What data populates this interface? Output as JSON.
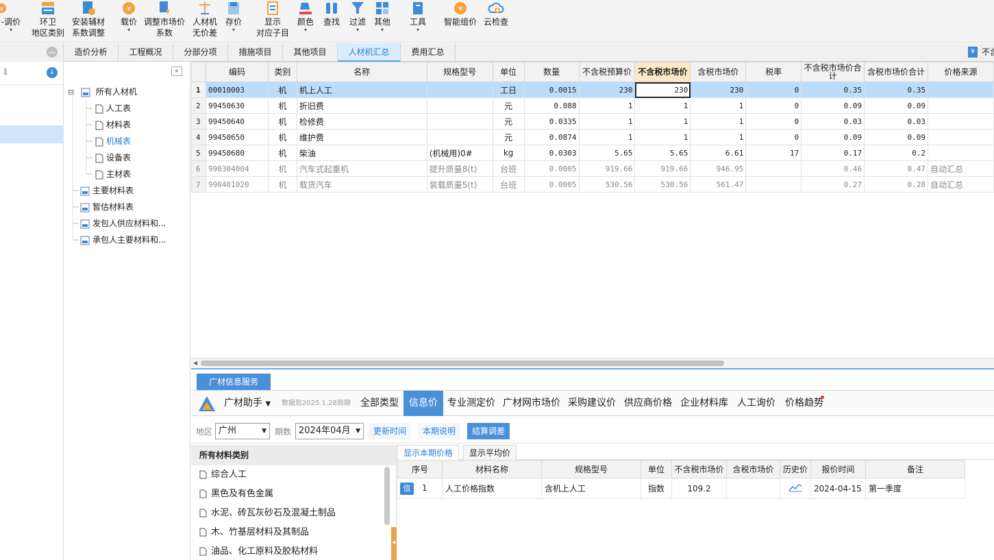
{
  "toolbar": {
    "items": [
      {
        "label": "-调价",
        "label2": "",
        "caret": true
      },
      {
        "label": "环卫",
        "label2": "地区类别",
        "caret": false
      },
      {
        "label": "安装辅材",
        "label2": "系数调整",
        "caret": false
      },
      {
        "label": "载价",
        "label2": "",
        "caret": true
      },
      {
        "label": "调整市场价",
        "label2": "系数",
        "caret": false
      },
      {
        "label": "人材机",
        "label2": "无价差",
        "caret": false
      },
      {
        "label": "存价",
        "label2": "",
        "caret": true
      },
      {
        "label": "显示",
        "label2": "对应子目",
        "caret": false
      },
      {
        "label": "颜色",
        "label2": "",
        "caret": true
      },
      {
        "label": "查找",
        "label2": "",
        "caret": false
      },
      {
        "label": "过滤",
        "label2": "",
        "caret": true
      },
      {
        "label": "其他",
        "label2": "",
        "caret": true
      },
      {
        "label": "工具",
        "label2": "",
        "caret": true
      },
      {
        "label": "智能组价",
        "label2": "",
        "caret": false
      },
      {
        "label": "云检查",
        "label2": "",
        "caret": false
      }
    ],
    "caret_glyph": "▾"
  },
  "tabs": [
    "造价分析",
    "工程概况",
    "分部分项",
    "措施项目",
    "其他项目",
    "人材机汇总",
    "费用汇总"
  ],
  "tab_right_label": "不含",
  "tree": {
    "root": "所有人材机",
    "children": [
      "人工表",
      "材料表",
      "机械表",
      "设备表",
      "主材表"
    ],
    "others": [
      "主要材料表",
      "暂估材料表",
      "发包人供应材料和...",
      "承包人主要材料和..."
    ],
    "collapse_glyph": "⊟"
  },
  "grid": {
    "headers": [
      "编码",
      "类别",
      "名称",
      "规格型号",
      "单位",
      "数量",
      "不含税预算价",
      "不含税市场价",
      "含税市场价",
      "税率",
      "不含税市场价合计",
      "含税市场价合计",
      "价格来源"
    ],
    "rows": [
      [
        "1",
        "00010003",
        "机",
        "机上人工",
        "",
        "工日",
        "0.0015",
        "230",
        "230",
        "230",
        "0",
        "0.35",
        "0.35",
        ""
      ],
      [
        "2",
        "99450630",
        "机",
        "折旧费",
        "",
        "元",
        "0.088",
        "1",
        "1",
        "1",
        "0",
        "0.09",
        "0.09",
        ""
      ],
      [
        "3",
        "99450640",
        "机",
        "检修费",
        "",
        "元",
        "0.0335",
        "1",
        "1",
        "1",
        "0",
        "0.03",
        "0.03",
        ""
      ],
      [
        "4",
        "99450650",
        "机",
        "维护费",
        "",
        "元",
        "0.0874",
        "1",
        "1",
        "1",
        "0",
        "0.09",
        "0.09",
        ""
      ],
      [
        "5",
        "99450680",
        "机",
        "柴油",
        "(机械用)0#",
        "kg",
        "0.0303",
        "5.65",
        "5.65",
        "6.61",
        "17",
        "0.17",
        "0.2",
        ""
      ],
      [
        "6",
        "990304004",
        "机",
        "汽车式起重机",
        "提升质量8(t)",
        "台班",
        "0.0005",
        "919.66",
        "919.66",
        "946.95",
        "",
        "0.46",
        "0.47",
        "自动汇总"
      ],
      [
        "7",
        "990401020",
        "机",
        "载货汽车",
        "装载质量5(t)",
        "台班",
        "0.0005",
        "530.56",
        "530.56",
        "561.47",
        "",
        "0.27",
        "0.28",
        "自动汇总"
      ]
    ]
  },
  "bottom": {
    "service_tab": "广材信息服务",
    "assistant": "广材助手",
    "data_pkg": "数据包2025.1.28到期",
    "service_items": [
      "全部类型",
      "信息价",
      "专业测定价",
      "广材网市场价",
      "采购建议价",
      "供应商价格",
      "企业材料库",
      "人工询价",
      "价格趋势"
    ],
    "filters": {
      "region_label": "地区",
      "region_value": "广州",
      "period_label": "期数",
      "period_value": "2024年04月",
      "btn_update": "更新时间",
      "btn_notes": "本期说明",
      "btn_settle": "结算调差"
    },
    "categories": {
      "title": "所有材料类别",
      "items": [
        "综合人工",
        "黑色及有色金属",
        "水泥、砖瓦灰砂石及混凝土制品",
        "木、竹基层材料及其制品",
        "油品、化工原料及胶粘材料"
      ]
    },
    "price_tabs": [
      "显示本期价格",
      "显示平均价"
    ],
    "price_headers": [
      "序号",
      "材料名称",
      "规格型号",
      "单位",
      "不含税市场价",
      "含税市场价",
      "历史价",
      "报价时间",
      "备注"
    ],
    "price_rows": [
      {
        "badge": "信",
        "no": "1",
        "name": "人工价格指数",
        "spec": "含机上人工",
        "unit": "指数",
        "price": "109.2",
        "tax_price": "",
        "time": "2024-04-15",
        "remark": "第一季度"
      }
    ]
  },
  "colors": {
    "accent": "#4a90d9",
    "selection": "#bcdcfb",
    "highlight_header": "#fde8c8"
  }
}
